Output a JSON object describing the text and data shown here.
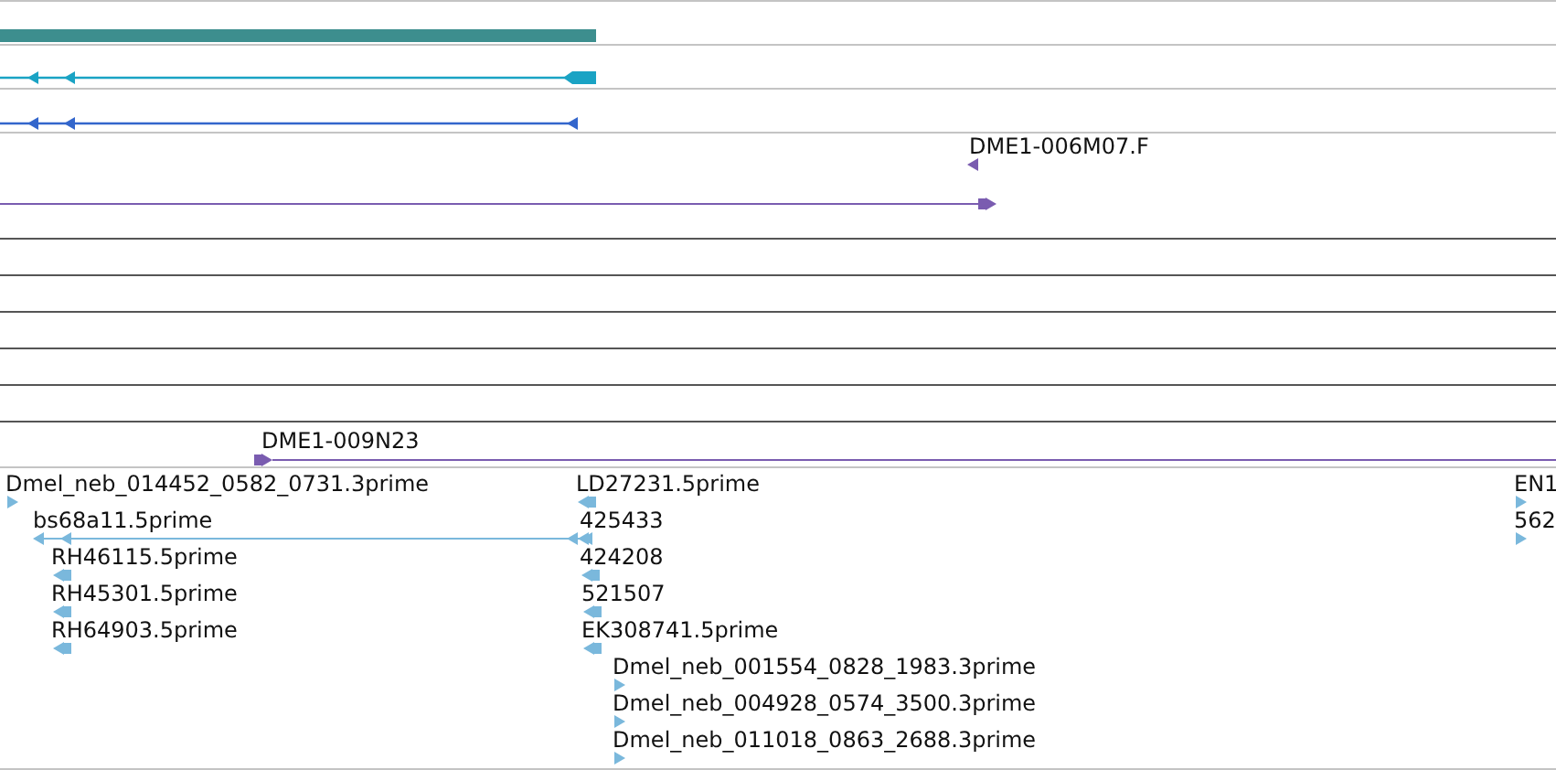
{
  "tracks": [
    {
      "kind": "bar",
      "color": "#3d8e8e"
    },
    {
      "kind": "gene",
      "color": "#1aa3c4"
    },
    {
      "kind": "gene",
      "color": "#3366cc"
    },
    {
      "kind": "clone",
      "color": "#7a5cb0",
      "label": "DME1-006M07.F",
      "reverse": true
    },
    {
      "kind": "clone",
      "color": "#7a5cb0",
      "reverse": false
    },
    {
      "kind": "span"
    },
    {
      "kind": "span"
    },
    {
      "kind": "span"
    },
    {
      "kind": "span"
    },
    {
      "kind": "span"
    },
    {
      "kind": "span"
    },
    {
      "kind": "clone",
      "color": "#7a5cb0",
      "label": "DME1-009N23",
      "reverse": false
    }
  ],
  "est_track": {
    "color": "#7ab8dc",
    "features": [
      {
        "label": "Dmel_neb_014452_0582_0731.3prime",
        "reverse": false
      },
      {
        "label": "bs68a11.5prime",
        "reverse": true
      },
      {
        "label": "RH46115.5prime",
        "reverse": true
      },
      {
        "label": "RH45301.5prime",
        "reverse": true
      },
      {
        "label": "RH64903.5prime",
        "reverse": true
      },
      {
        "label": "LD27231.5prime",
        "reverse": true
      },
      {
        "label": "425433",
        "reverse": true
      },
      {
        "label": "424208",
        "reverse": true
      },
      {
        "label": "521507",
        "reverse": true
      },
      {
        "label": "EK308741.5prime",
        "reverse": true
      },
      {
        "label": "Dmel_neb_001554_0828_1983.3prime",
        "reverse": false
      },
      {
        "label": "Dmel_neb_004928_0574_3500.3prime",
        "reverse": false
      },
      {
        "label": "Dmel_neb_011018_0863_2688.3prime",
        "reverse": false
      },
      {
        "label": "EN1",
        "reverse": false
      },
      {
        "label": "562",
        "reverse": false
      }
    ]
  }
}
